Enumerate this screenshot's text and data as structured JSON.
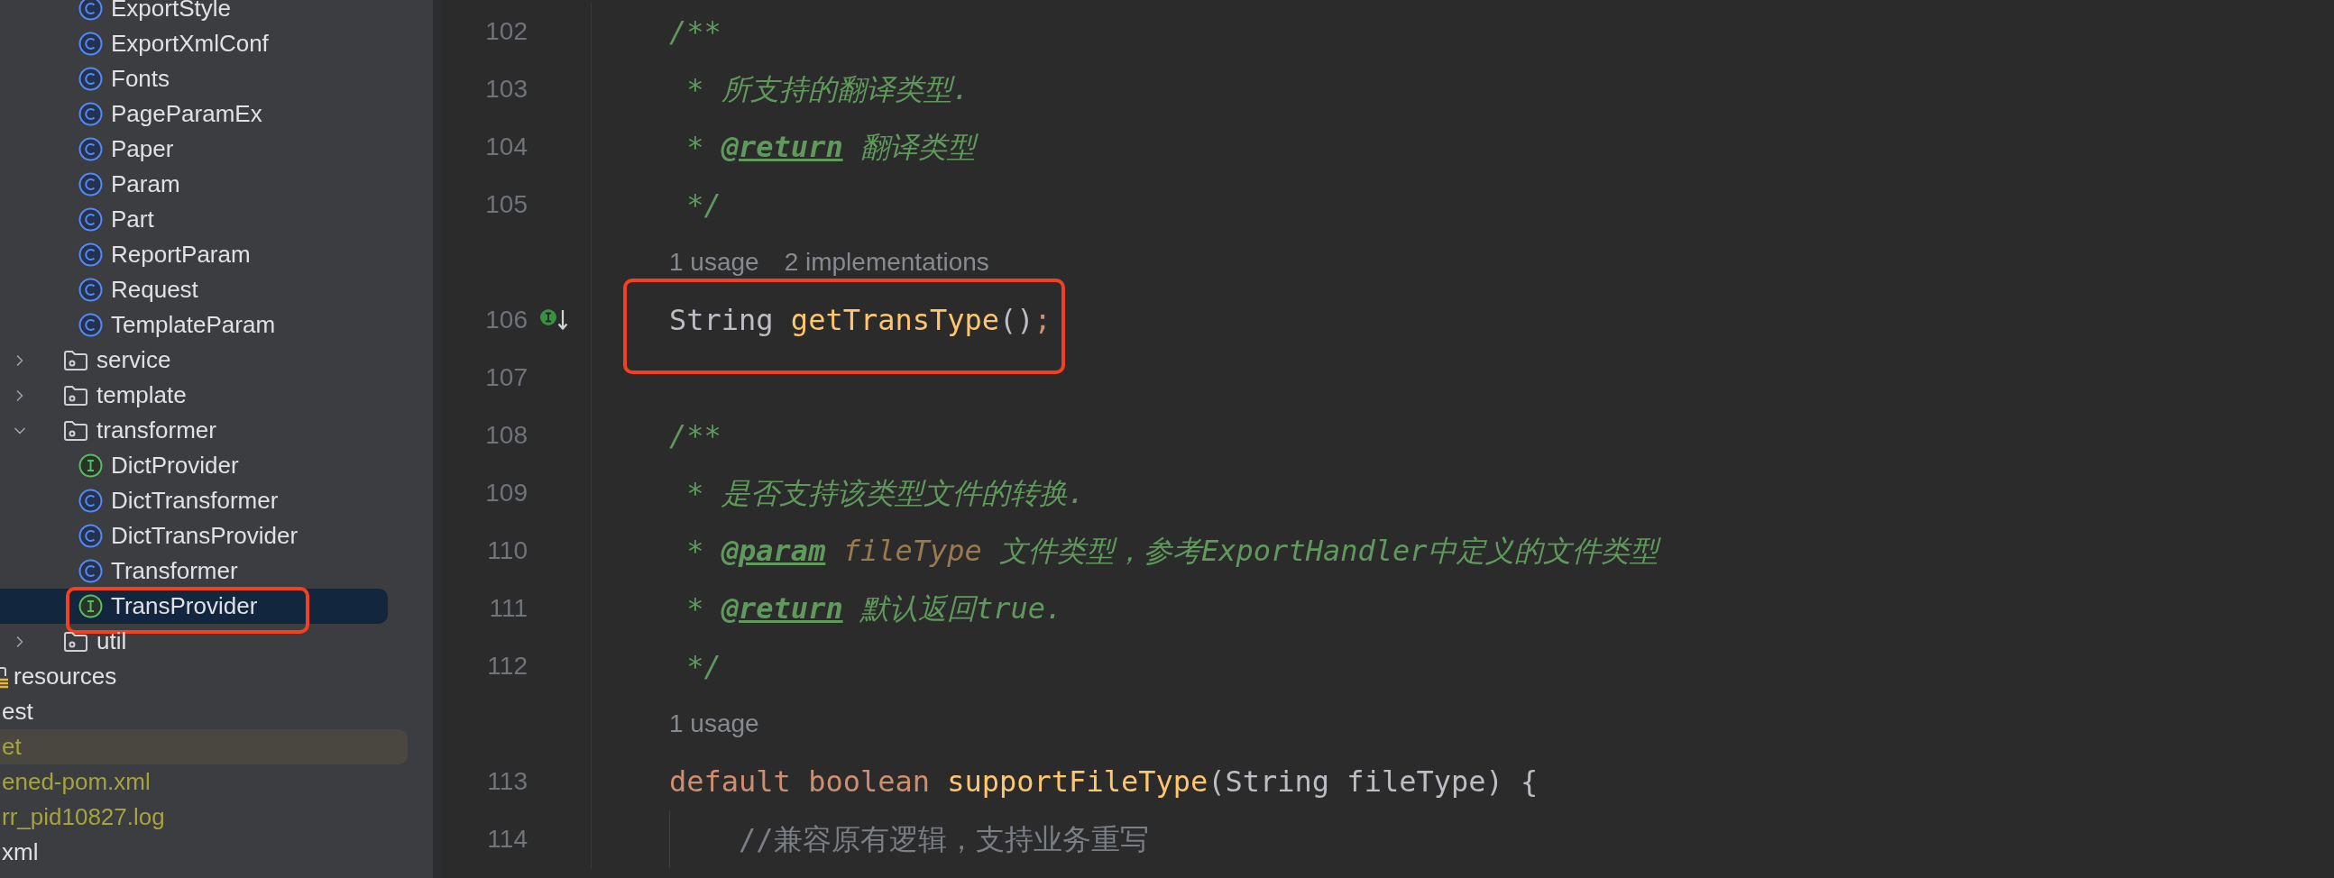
{
  "project_tree": {
    "package_items": [
      {
        "label": "ExportStyle",
        "kind": "class",
        "selected": false,
        "annotated": false
      },
      {
        "label": "ExportXmlConf",
        "kind": "class",
        "selected": false,
        "annotated": false
      },
      {
        "label": "Fonts",
        "kind": "class",
        "selected": false,
        "annotated": false
      },
      {
        "label": "PageParamEx",
        "kind": "class",
        "selected": false,
        "annotated": false
      },
      {
        "label": "Paper",
        "kind": "class",
        "selected": false,
        "annotated": false
      },
      {
        "label": "Param",
        "kind": "class",
        "selected": false,
        "annotated": false
      },
      {
        "label": "Part",
        "kind": "class",
        "selected": false,
        "annotated": false
      },
      {
        "label": "ReportParam",
        "kind": "class",
        "selected": false,
        "annotated": false
      },
      {
        "label": "Request",
        "kind": "class",
        "selected": false,
        "annotated": false
      },
      {
        "label": "TemplateParam",
        "kind": "class",
        "selected": false,
        "annotated": false
      }
    ],
    "folders": [
      {
        "label": "service",
        "kind": "folder",
        "expanded": false,
        "selected": false,
        "annotated": false
      },
      {
        "label": "template",
        "kind": "folder",
        "expanded": false,
        "selected": false,
        "annotated": false
      },
      {
        "label": "transformer",
        "kind": "folder",
        "expanded": true,
        "selected": false,
        "annotated": false,
        "children": [
          {
            "label": "DictProvider",
            "kind": "interface",
            "selected": false,
            "annotated": false
          },
          {
            "label": "DictTransformer",
            "kind": "class",
            "selected": false,
            "annotated": false
          },
          {
            "label": "DictTransProvider",
            "kind": "class",
            "selected": false,
            "annotated": false
          },
          {
            "label": "Transformer",
            "kind": "class",
            "selected": false,
            "annotated": false
          },
          {
            "label": "TransProvider",
            "kind": "interface",
            "selected": true,
            "annotated": true
          }
        ]
      },
      {
        "label": "util",
        "kind": "folder",
        "expanded": false,
        "selected": false,
        "annotated": false
      }
    ],
    "module_items": [
      {
        "label": "resources",
        "kind": "resources",
        "selected": false,
        "highlighted": false,
        "ignored": false
      },
      {
        "label": "est",
        "kind": "plain",
        "selected": false,
        "highlighted": false,
        "ignored": false
      },
      {
        "label": "et",
        "kind": "plain",
        "selected": false,
        "highlighted": true,
        "ignored": true
      },
      {
        "label": "ened-pom.xml",
        "kind": "plain",
        "selected": false,
        "highlighted": false,
        "ignored": true
      },
      {
        "label": "rr_pid10827.log",
        "kind": "plain",
        "selected": false,
        "highlighted": false,
        "ignored": true
      },
      {
        "label": "xml",
        "kind": "plain",
        "selected": false,
        "highlighted": false,
        "ignored": false
      }
    ]
  },
  "editor": {
    "lines": [
      {
        "kind": "code",
        "number": "102",
        "annotated": false,
        "tokens": [
          {
            "text": "/**",
            "kind": "doc"
          }
        ]
      },
      {
        "kind": "code",
        "number": "103",
        "annotated": false,
        "tokens": [
          {
            "text": " * 所支持的翻译类型.",
            "kind": "doc"
          }
        ]
      },
      {
        "kind": "code",
        "number": "104",
        "annotated": false,
        "tokens": [
          {
            "text": " * ",
            "kind": "doc"
          },
          {
            "text": "@return",
            "kind": "doc-tag"
          },
          {
            "text": " 翻译类型",
            "kind": "doc"
          }
        ]
      },
      {
        "kind": "code",
        "number": "105",
        "annotated": false,
        "tokens": [
          {
            "text": " */",
            "kind": "doc"
          }
        ]
      },
      {
        "kind": "hint",
        "hints": [
          "1 usage",
          "2 implementations"
        ]
      },
      {
        "kind": "code",
        "number": "106",
        "annotated": true,
        "implementation_marker": true,
        "tokens": [
          {
            "text": "String ",
            "kind": "plain"
          },
          {
            "text": "getTransType",
            "kind": "method"
          },
          {
            "text": "()",
            "kind": "plain"
          },
          {
            "text": ";",
            "kind": "accent"
          }
        ]
      },
      {
        "kind": "code",
        "number": "107"
      },
      {
        "kind": "code",
        "number": "108",
        "annotated": false,
        "tokens": [
          {
            "text": "/**",
            "kind": "doc"
          }
        ]
      },
      {
        "kind": "code",
        "number": "109",
        "annotated": false,
        "tokens": [
          {
            "text": " * 是否支持该类型文件的转换.",
            "kind": "doc"
          }
        ]
      },
      {
        "kind": "code",
        "number": "110",
        "annotated": false,
        "tokens": [
          {
            "text": " * ",
            "kind": "doc"
          },
          {
            "text": "@param",
            "kind": "doc-tag"
          },
          {
            "text": " fileType",
            "kind": "doc-param"
          },
          {
            "text": " 文件类型，参考",
            "kind": "doc"
          },
          {
            "text": "ExportHandler",
            "kind": "doc-italic"
          },
          {
            "text": "中定义的文件类型",
            "kind": "doc"
          }
        ]
      },
      {
        "kind": "code",
        "number": "111",
        "annotated": false,
        "tokens": [
          {
            "text": " * ",
            "kind": "doc"
          },
          {
            "text": "@return",
            "kind": "doc-tag"
          },
          {
            "text": " 默认返回",
            "kind": "doc"
          },
          {
            "text": "true.",
            "kind": "doc-italic"
          }
        ]
      },
      {
        "kind": "code",
        "number": "112",
        "annotated": false,
        "tokens": [
          {
            "text": " */",
            "kind": "doc"
          }
        ]
      },
      {
        "kind": "hint",
        "hints": [
          "1 usage"
        ]
      },
      {
        "kind": "code",
        "number": "113",
        "annotated": false,
        "tokens": [
          {
            "text": "default boolean ",
            "kind": "keyword"
          },
          {
            "text": "supportFileType",
            "kind": "method"
          },
          {
            "text": "(String fileType) {",
            "kind": "plain"
          }
        ]
      },
      {
        "kind": "code",
        "number": "114",
        "annotated": false,
        "nested": true,
        "tokens": [
          {
            "text": "//兼容原有逻辑，支持业务重写",
            "kind": "line-comment"
          }
        ]
      }
    ]
  }
}
